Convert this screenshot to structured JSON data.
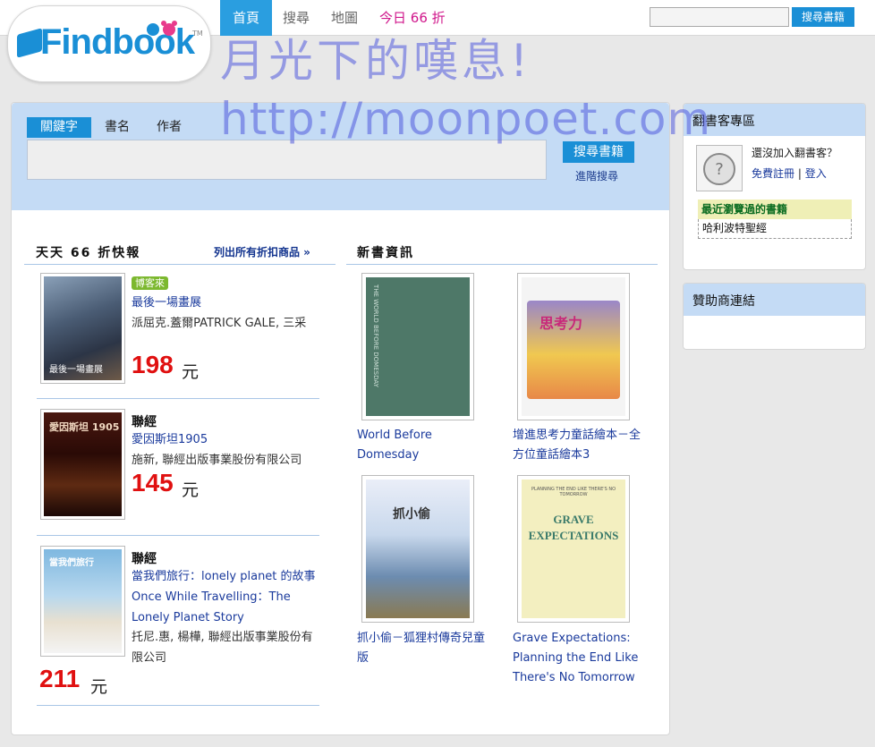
{
  "brand": {
    "name": "Findbook",
    "tm": "TM"
  },
  "nav": {
    "items": [
      "首頁",
      "搜尋",
      "地圖"
    ],
    "promo": "今日 66 折"
  },
  "top_search": {
    "button": "搜尋書籍"
  },
  "watermark": {
    "line1": "月光下的嘆息!",
    "line2": "http://moonpoet.com"
  },
  "search": {
    "tabs": [
      "關鍵字",
      "書名",
      "作者"
    ],
    "button": "搜尋書籍",
    "advanced": "進階搜尋"
  },
  "deals": {
    "heading": "天天 66 折快報",
    "list_all": "列出所有折扣商品 »",
    "currency": "元",
    "items": [
      {
        "publisher": "博客來",
        "title": "最後一場畫展",
        "author": "派屈克.蓋爾PATRICK GALE, 三采",
        "price": "198",
        "cover_text": "最後一場畫展"
      },
      {
        "publisher": "聯經",
        "title": "愛因斯坦1905",
        "author": "施新, 聯經出版事業股份有限公司",
        "price": "145",
        "cover_text": "愛因斯坦 1905"
      },
      {
        "publisher": "聯經",
        "title": "當我們旅行：lonely planet 的故事Once While Travelling：The Lonely Planet Story",
        "author": "托尼.惠, 楊樺, 聯經出版事業股份有限公司",
        "price": "211",
        "cover_text": "當我們旅行"
      }
    ]
  },
  "new_books": {
    "heading": "新書資訊",
    "items": [
      {
        "title": "World Before Domesday",
        "cover_text": "THE WORLD BEFORE DOMESDAY"
      },
      {
        "title": "增進思考力童話繪本－全方位童話繪本3",
        "cover_text": "思考力"
      },
      {
        "title": "抓小偷－狐狸村傳奇兒童版",
        "cover_text": "抓小偷"
      },
      {
        "title": "Grave Expectations: Planning the End Like There's No Tomorrow",
        "cover_text": "GRAVE EXPECTATIONS",
        "cover_sub": "PLANNING THE END LIKE THERE'S NO TOMORROW"
      }
    ]
  },
  "sidebar": {
    "member": {
      "heading": "翻書客專區",
      "question": "還沒加入翻書客？",
      "register": "免費註冊",
      "sep": "|",
      "login": "登入",
      "recent_heading": "最近瀏覽過的書籍",
      "recent": [
        "哈利波特聖經"
      ]
    },
    "sponsor": {
      "heading": "贊助商連結"
    }
  }
}
